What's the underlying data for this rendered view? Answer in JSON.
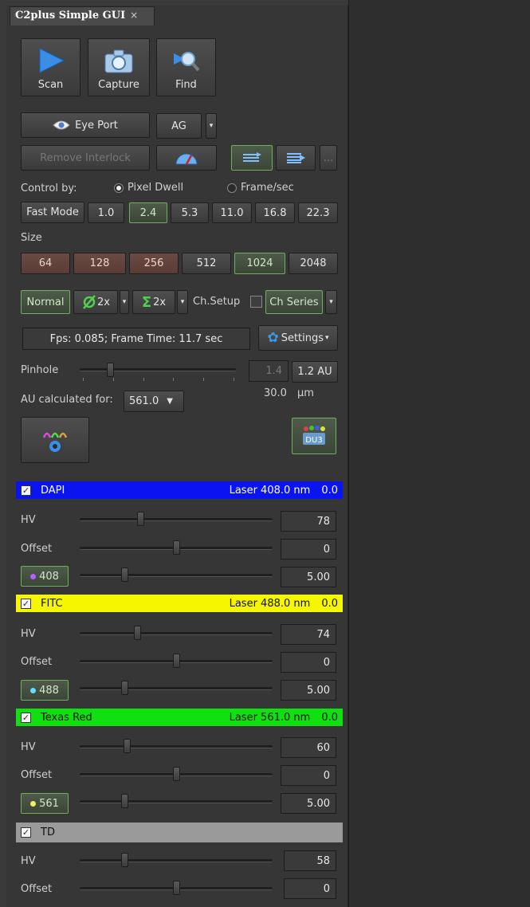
{
  "tab": {
    "title": "C2plus Simple GUI",
    "close": "×"
  },
  "toolbar": {
    "scan": "Scan",
    "capture": "Capture",
    "find": "Find"
  },
  "eyeport": {
    "label": "Eye Port",
    "ag": "AG",
    "remove_interlock": "Remove Interlock",
    "more": "..."
  },
  "control": {
    "label": "Control by:",
    "pixel_dwell": "Pixel Dwell",
    "frame_sec": "Frame/sec",
    "fast_mode": "Fast Mode",
    "speeds": [
      "1.0",
      "2.4",
      "5.3",
      "11.0",
      "16.8",
      "22.3"
    ],
    "selected_speed": "2.4"
  },
  "size": {
    "label": "Size",
    "options": [
      "64",
      "128",
      "256",
      "512",
      "1024",
      "2048"
    ],
    "selected": "1024"
  },
  "scanmode": {
    "normal": "Normal",
    "avg": "2x",
    "sum": "2x",
    "ch_setup": "Ch.Setup",
    "ch_series": "Ch Series"
  },
  "status": {
    "fps": "Fps: 0.085; Frame Time: 11.7 sec",
    "settings": "Settings"
  },
  "pinhole": {
    "label": "Pinhole",
    "value": "1.4",
    "au": "1.2 AU",
    "um_value": "30.0",
    "um_unit": "µm",
    "au_calc_label": "AU calculated for:",
    "au_calc_value": "561.0"
  },
  "channels": [
    {
      "name": "DAPI",
      "laser": "Laser 408.0 nm",
      "laser_val": "0.0",
      "color": "#0a14f0",
      "hv": "78",
      "offset": "0",
      "line": "408",
      "power": "5.00",
      "dot": "#b060ff",
      "text": "#ffffff"
    },
    {
      "name": "FITC",
      "laser": "Laser 488.0 nm",
      "laser_val": "0.0",
      "color": "#f6f600",
      "hv": "74",
      "offset": "0",
      "line": "488",
      "power": "5.00",
      "dot": "#60e0ff",
      "text": "#111111"
    },
    {
      "name": "Texas Red",
      "laser": "Laser 561.0 nm",
      "laser_val": "0.0",
      "color": "#10e010",
      "hv": "60",
      "offset": "0",
      "line": "561",
      "power": "5.00",
      "dot": "#f0f060",
      "text": "#111111"
    },
    {
      "name": "TD",
      "hv": "58",
      "offset": "0",
      "color": "#9a9a9a",
      "text": "#111111"
    }
  ],
  "labels": {
    "hv": "HV",
    "offset": "Offset"
  }
}
